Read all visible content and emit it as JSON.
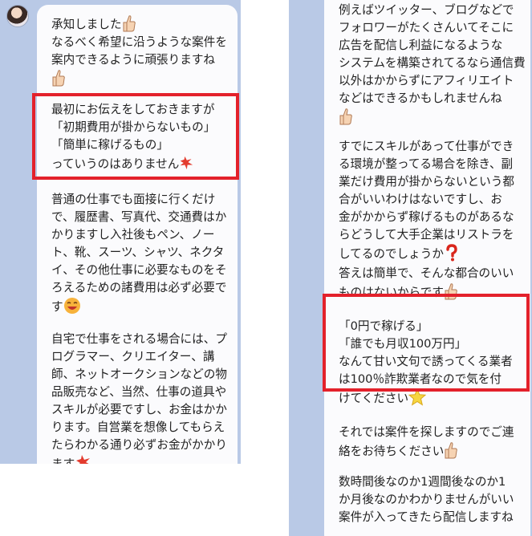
{
  "left": {
    "messages": [
      [
        "承知しました",
        "なるべく希望に沿うような案件を",
        "案内できるように頑張りますね"
      ],
      [
        "最初にお伝えをしておきますが",
        "「初期費用が掛からないもの」",
        "「簡単に稼げるもの」",
        "っていうのはありません"
      ],
      [
        "普通の仕事でも面接に行くだけ",
        "で、履歴書、写真代、交通費はか",
        "かりますし入社後もペン、ノー",
        "ト、靴、スーツ、シャツ、ネクタ",
        "イ、その他仕事に必要なものをそ",
        "ろえるための諸費用は必ず必要で",
        "す"
      ],
      [
        "自宅で仕事をされる場合には、プ",
        "ログラマー、クリエイター、講",
        "師、ネットオークションなどの物",
        "品販売など、当然、仕事の道具や",
        "スキルが必要ですし、お金はかか",
        "ります。自営業を想像してもらえ",
        "たらわかる通り必ずお金がかかり",
        "ます"
      ]
    ]
  },
  "right": {
    "messages": [
      [
        "例えばツイッター、ブログなどで",
        "フォロワーがたくさんいてそこに",
        "広告を配信し利益になるような",
        "システムを構築されてるなら通信費",
        "以外はかからずにアフィリエイト",
        "などはできるかもしれませんね"
      ],
      [
        "すでにスキルがあって仕事ができ",
        "る環境が整ってる場合を除き、副",
        "業だけ費用が掛からないという都",
        "合がいいわけはないですし、お",
        "金がかからず稼げるものがあるな",
        "らどうして大手企業はリストラを",
        "してるのでしょうか",
        "答えは簡単で、そんな都合のいい",
        "ものはないからです"
      ],
      [
        "「0円で稼げる」",
        "「誰でも月収100万円」",
        "なんて甘い文句で誘ってくる業者",
        "は100％詐欺業者なので気を付",
        "けてください"
      ],
      [
        "それでは案件を探しますのでご連",
        "絡をお待ちください"
      ],
      [
        "数時間後なのか1週間後なのか1",
        "か月後なのかわかりませんがいい",
        "案件が入ってきたら配信しますね"
      ]
    ]
  },
  "icons": [
    "thumbs-up-icon",
    "sweat-mark-icon",
    "smiling-face-icon",
    "question-mark-icon",
    "star-icon"
  ],
  "colors": {
    "background": "#b9c9e6",
    "bubble": "#fbfbfd",
    "highlight_border": "#e3212b"
  }
}
